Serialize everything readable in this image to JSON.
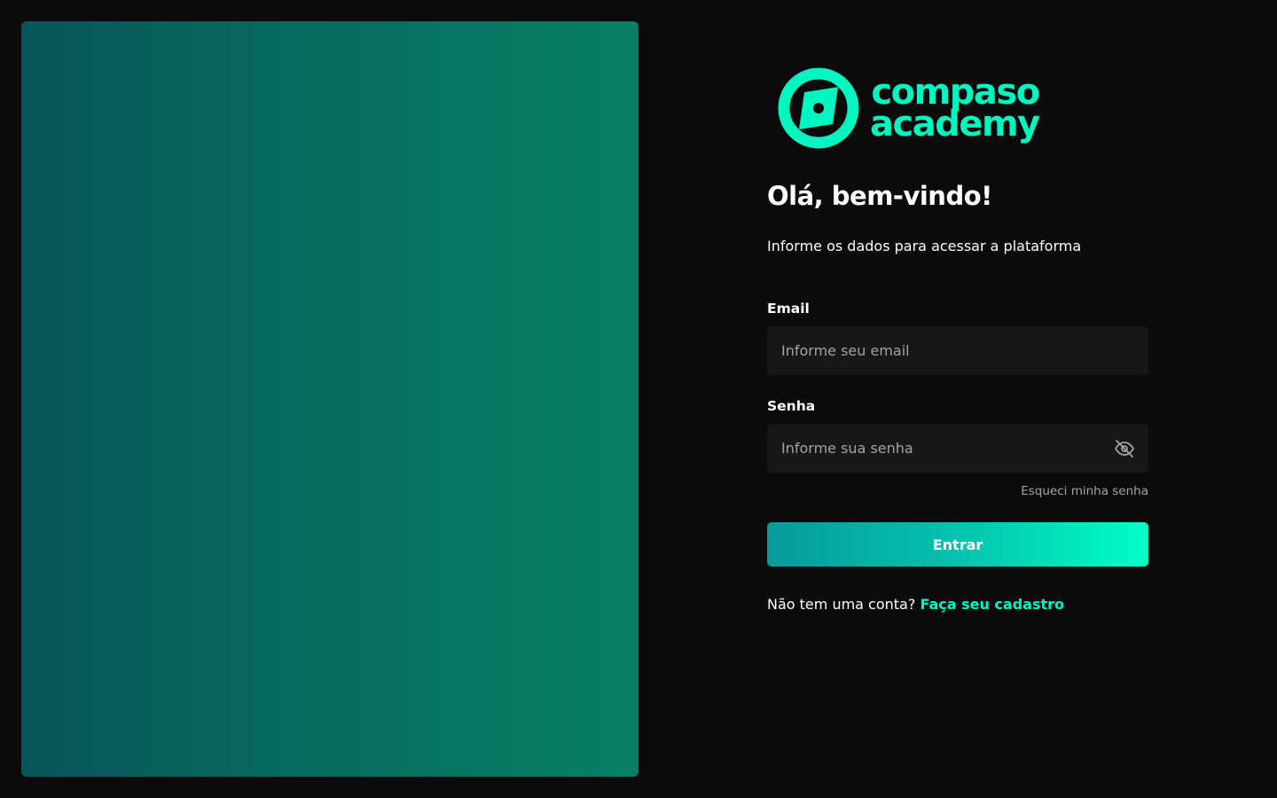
{
  "brand": {
    "name_line1": "compaso",
    "name_line2": "academy",
    "logo_icon": "compass-icon",
    "accent_color": "#00f5c0"
  },
  "login": {
    "title": "Olá, bem-vindo!",
    "subtitle": "Informe os dados para acessar a plataforma",
    "email_label": "Email",
    "email_placeholder": "Informe seu email",
    "email_value": "",
    "password_label": "Senha",
    "password_placeholder": "Informe sua senha",
    "password_value": "",
    "password_toggle_icon": "eye-off-icon",
    "forgot_password": "Esqueci minha senha",
    "submit_label": "Entrar",
    "signup_prompt": "Não tem uma conta?",
    "signup_link": "Faça seu cadastro"
  }
}
